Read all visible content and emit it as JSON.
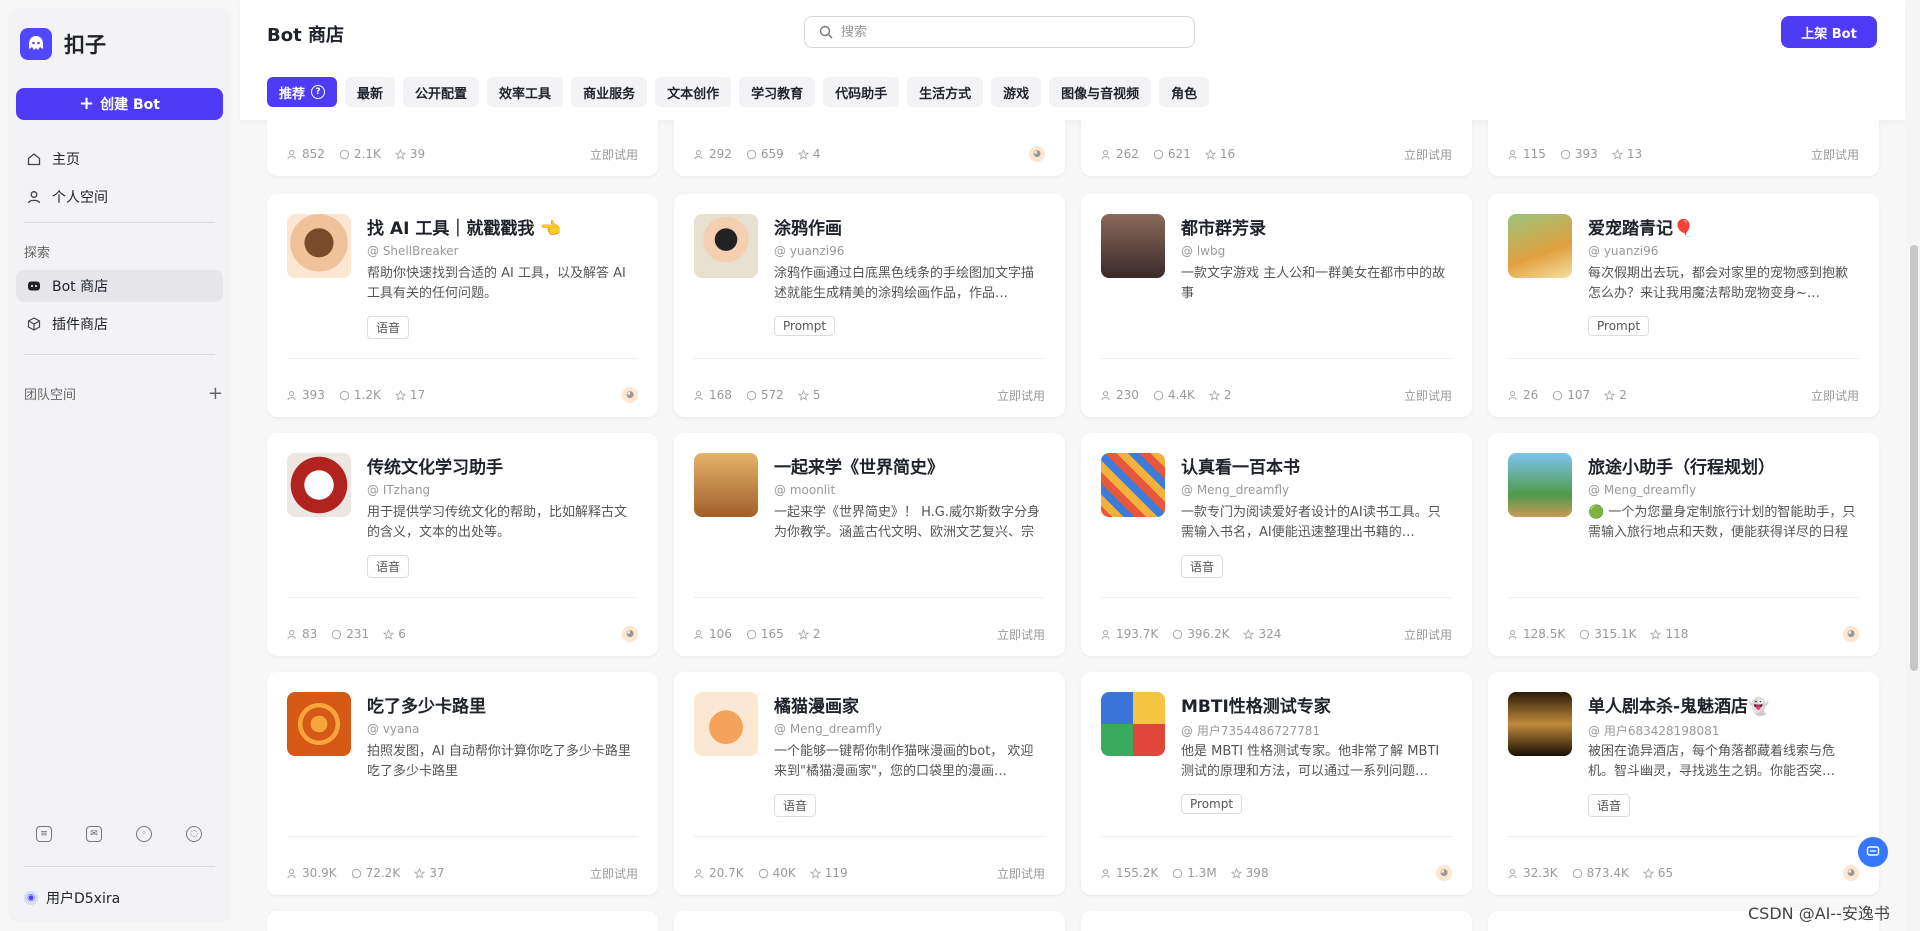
{
  "sidebar": {
    "brand": "扣子",
    "create_label": "创建 Bot",
    "home": "主页",
    "personal": "个人空间",
    "explore": "探索",
    "bot_store": "Bot 商店",
    "plugin_store": "插件商店",
    "team": "团队空间",
    "user": "用户D5xira"
  },
  "header": {
    "title": "Bot 商店",
    "search_placeholder": "搜索",
    "publish_label": "上架 Bot",
    "tabs": [
      "推荐",
      "最新",
      "公开配置",
      "效率工具",
      "商业服务",
      "文本创作",
      "学习教育",
      "代码助手",
      "生活方式",
      "游戏",
      "图像与音视频",
      "角色"
    ]
  },
  "top_row": [
    {
      "users": "852",
      "chats": "2.1K",
      "stars": "39",
      "try": "立即试用"
    },
    {
      "users": "292",
      "chats": "659",
      "stars": "4"
    },
    {
      "users": "262",
      "chats": "621",
      "stars": "16",
      "try": "立即试用"
    },
    {
      "users": "115",
      "chats": "393",
      "stars": "13",
      "try": "立即试用"
    }
  ],
  "cards": [
    {
      "title": "找 AI 工具｜就戳戳我 👈",
      "author": "@ ShellBreaker",
      "desc": "帮助你快速找到合适的 AI 工具，以及解答 AI 工具有关的任何问题。",
      "tag": "语音",
      "users": "393",
      "chats": "1.2K",
      "stars": "17",
      "try": ""
    },
    {
      "title": "涂鸦作画",
      "author": "@ yuanzi96",
      "desc": "涂鸦作画通过白底黑色线条的手绘图加文字描述就能生成精美的涂鸦绘画作品，作品…",
      "tag": "Prompt",
      "users": "168",
      "chats": "572",
      "stars": "5",
      "try": "立即试用"
    },
    {
      "title": "都市群芳录",
      "author": "@ lwbg",
      "desc": "一款文字游戏 主人公和一群美女在都市中的故事",
      "tag": "",
      "users": "230",
      "chats": "4.4K",
      "stars": "2",
      "try": "立即试用"
    },
    {
      "title": "爱宠踏青记🎈",
      "author": "@ yuanzi96",
      "desc": "每次假期出去玩，都会对家里的宠物感到抱歉怎么办？来让我用魔法帮助宠物变身~…",
      "tag": "Prompt",
      "users": "26",
      "chats": "107",
      "stars": "2",
      "try": "立即试用"
    },
    {
      "title": "传统文化学习助手",
      "author": "@ ITzhang",
      "desc": "用于提供学习传统文化的帮助，比如解释古文的含义，文本的出处等。",
      "tag": "语音",
      "users": "83",
      "chats": "231",
      "stars": "6",
      "try": ""
    },
    {
      "title": "一起来学《世界简史》",
      "author": "@ moonlit",
      "desc": "一起来学《世界简史》！ H.G.威尔斯数字分身为你教学。涵盖古代文明、欧洲文艺复兴、宗教改革、工业革命、美国独立战争…",
      "tag": "",
      "users": "106",
      "chats": "165",
      "stars": "2",
      "try": "立即试用"
    },
    {
      "title": "认真看一百本书",
      "author": "@ Meng_dreamfly",
      "desc": "一款专门为阅读爱好者设计的AI读书工具。只需输入书名，AI便能迅速整理出书籍的…",
      "tag": "语音",
      "users": "193.7K",
      "chats": "396.2K",
      "stars": "324",
      "try": "立即试用"
    },
    {
      "title": "旅途小助手（行程规划）",
      "author": "@ Meng_dreamfly",
      "desc": "🟢 一个为您量身定制旅行计划的智能助手，只需输入旅行地点和天数，便能获得详尽的日程安排和美食推荐。让您的旅途轻…",
      "tag": "",
      "users": "128.5K",
      "chats": "315.1K",
      "stars": "118",
      "try": ""
    },
    {
      "title": "吃了多少卡路里",
      "author": "@ vyana",
      "desc": "拍照发图，AI 自动帮你计算你吃了多少卡路里 吃了多少卡路里",
      "tag": "",
      "users": "30.9K",
      "chats": "72.2K",
      "stars": "37",
      "try": "立即试用"
    },
    {
      "title": "橘猫漫画家",
      "author": "@ Meng_dreamfly",
      "desc": "一个能够一键帮你制作猫咪漫画的bot， 欢迎来到\"橘猫漫画家\"，您的口袋里的漫画…",
      "tag": "语音",
      "users": "20.7K",
      "chats": "40K",
      "stars": "119",
      "try": "立即试用"
    },
    {
      "title": "MBTI性格测试专家",
      "author": "@ 用户7354486727781",
      "desc": "他是 MBTI 性格测试专家。他非常了解 MBTI 测试的原理和方法，可以通过一系列问题…",
      "tag": "Prompt",
      "users": "155.2K",
      "chats": "1.3M",
      "stars": "398",
      "try": ""
    },
    {
      "title": "单人剧本杀-鬼魅酒店👻",
      "author": "@ 用户683428198081",
      "desc": "被困在诡异酒店，每个角落都藏着线索与危机。智斗幽灵，寻找逃生之钥。你能否突…",
      "tag": "语音",
      "users": "32.3K",
      "chats": "873.4K",
      "stars": "65",
      "try": ""
    }
  ],
  "watermark": "CSDN @AI--安逸书",
  "colors": {
    "accent": "#4d3bf5",
    "fab": "#3578ff"
  }
}
